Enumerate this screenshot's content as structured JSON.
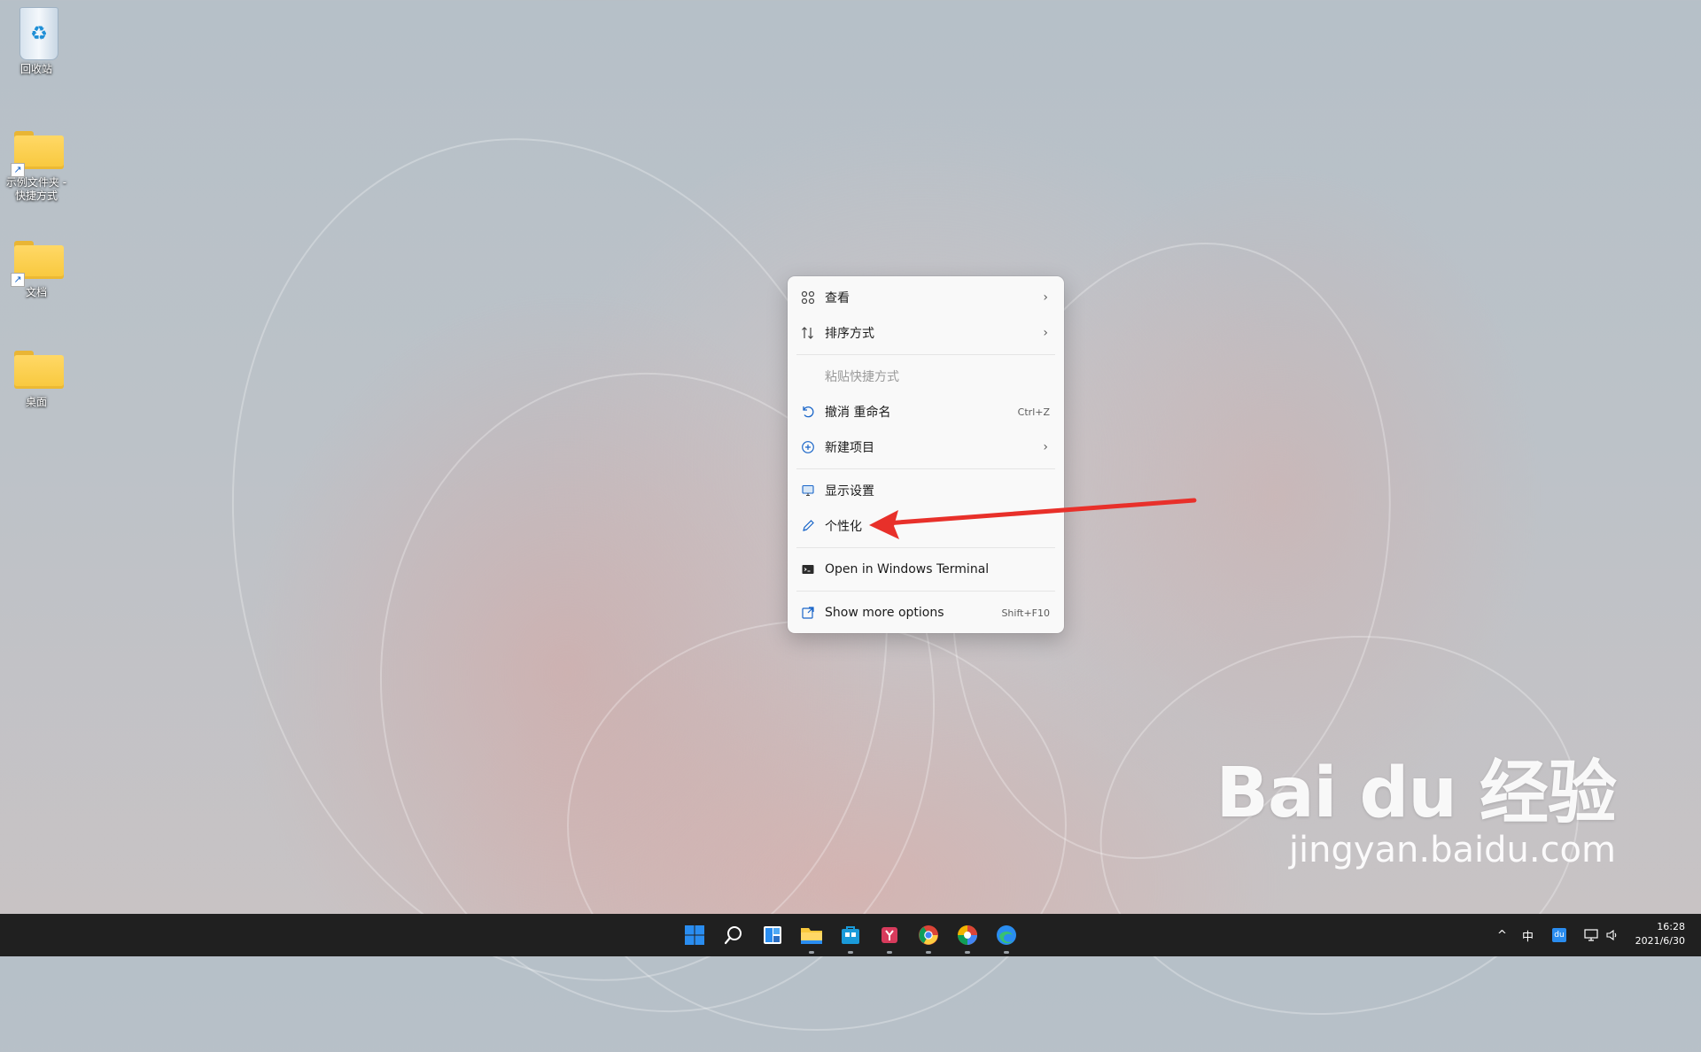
{
  "desktop": {
    "icons": [
      {
        "label": "回收站"
      },
      {
        "label": "示例文件夹 - 快捷方式"
      },
      {
        "label": "文档"
      },
      {
        "label": "桌面"
      }
    ]
  },
  "context_menu": {
    "items": [
      {
        "label": "查看",
        "icon": "view-grid-icon",
        "submenu": true
      },
      {
        "label": "排序方式",
        "icon": "sort-icon",
        "submenu": true
      },
      {
        "label": "粘贴快捷方式",
        "disabled": true
      },
      {
        "label": "撤消 重命名",
        "icon": "undo-icon",
        "shortcut": "Ctrl+Z"
      },
      {
        "label": "新建项目",
        "icon": "add-circle-icon",
        "submenu": true
      },
      {
        "label": "显示设置",
        "icon": "display-icon"
      },
      {
        "label": "个性化",
        "icon": "pen-icon"
      },
      {
        "label": "Open in Windows Terminal",
        "icon": "terminal-icon"
      },
      {
        "label": "Show more options",
        "icon": "open-external-icon",
        "shortcut": "Shift+F10"
      }
    ]
  },
  "annotation": {
    "color": "#e8302a"
  },
  "watermark": {
    "logo": "Bai du 经验",
    "url": "jingyan.baidu.com"
  },
  "taskbar": {
    "apps": [
      "start-icon",
      "search-icon",
      "widgets-icon",
      "file-explorer-icon",
      "store-icon",
      "office-icon",
      "chrome-icon",
      "photos-icon",
      "edge-icon"
    ],
    "tray": {
      "ime": "中",
      "time": "16:28",
      "date": "2021/6/30"
    }
  }
}
